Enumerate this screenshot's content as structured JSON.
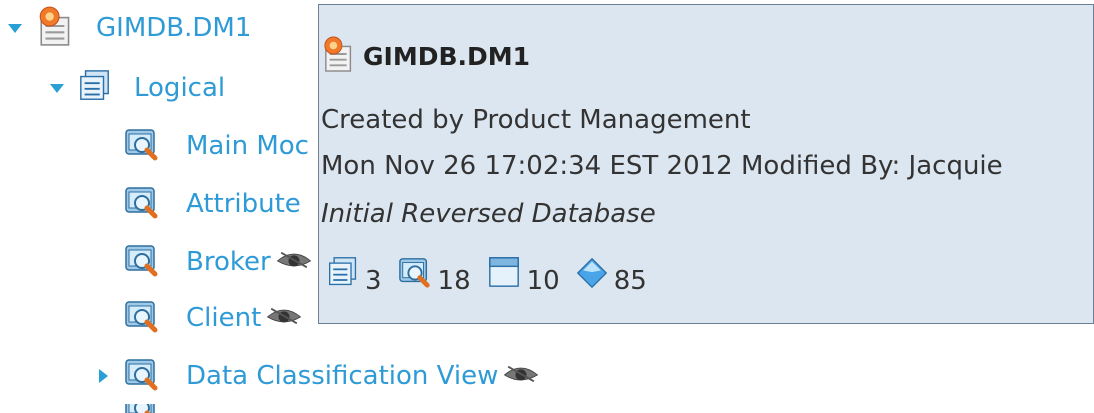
{
  "tree": {
    "root": {
      "label": "GIMDB.DM1"
    },
    "logical": {
      "label": "Logical"
    },
    "items": [
      {
        "label": "Main Moc"
      },
      {
        "label": "Attribute"
      },
      {
        "label": "Broker"
      },
      {
        "label": "Client"
      },
      {
        "label": "Data Classification View"
      }
    ]
  },
  "tooltip": {
    "title": "GIMDB.DM1",
    "created_by": "Created by Product Management",
    "modified": "Mon Nov 26 17:02:34 EST 2012 Modified By: Jacquie",
    "description": "Initial Reversed Database",
    "stats": {
      "models": "3",
      "submodels": "18",
      "entities": "10",
      "attributes": "85"
    }
  },
  "icons": {
    "expanded": "triangle-down-icon",
    "collapsed": "triangle-right-icon",
    "database": "database-model-icon",
    "logical": "logical-model-icon",
    "submodel": "submodel-view-icon",
    "hidden": "eye-icon"
  },
  "colors": {
    "link": "#2f9bd6",
    "tooltip_bg": "#dce6f0",
    "tooltip_border": "#6d7f93"
  }
}
